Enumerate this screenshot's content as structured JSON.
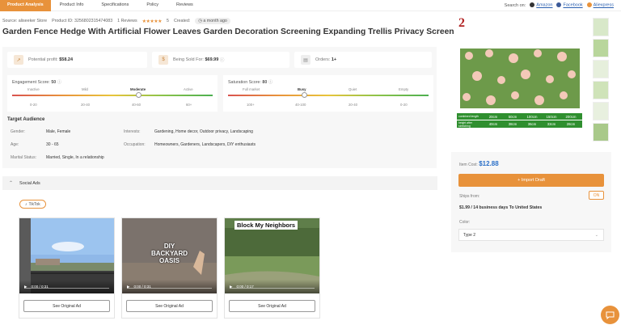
{
  "tabs": [
    "Product Analysis",
    "Product Info",
    "Specifications",
    "Policy",
    "Reviews"
  ],
  "search_on": {
    "label": "Search on:",
    "links": [
      "Amazon",
      "Facebook",
      "Aliexpress"
    ]
  },
  "meta": {
    "source": "Source: aliseeker Store",
    "product_id": "Product ID: 3256802315474083",
    "reviews": "1 Reviews",
    "stars": "★★★★★",
    "rating": "5",
    "created_label": "Created:",
    "created_value": "a month ago"
  },
  "title": "Garden Fence Hedge With Artificial Flower Leaves Garden Decoration Screening Expanding Trellis Privacy Screen",
  "stats": {
    "potential_profit_label": "Potential profit:",
    "potential_profit": "$58.24",
    "being_sold_label": "Being Sold For:",
    "being_sold": "$69.99",
    "orders_label": "Orders:",
    "orders": "1+"
  },
  "engagement": {
    "title": "Engagement Score:",
    "score": "50",
    "levels": [
      "Inactive",
      "Mild",
      "Moderate",
      "Active"
    ],
    "ranges": [
      "0-20",
      "20-40",
      "40-60",
      "60+"
    ],
    "active_level": "Moderate",
    "level_fraction": 0.63
  },
  "saturation": {
    "title": "Saturation Score:",
    "score": "80",
    "levels": [
      "Full market",
      "Busy",
      "Quiet",
      "Empty"
    ],
    "ranges": [
      "100+",
      "40-100",
      "20-40",
      "0-20"
    ],
    "active_level": "Busy",
    "level_fraction": 0.38
  },
  "audience": {
    "title": "Target Audience",
    "gender_label": "Gender:",
    "gender": "Male, Female",
    "age_label": "Age:",
    "age": "30 - 65",
    "marital_label": "Marital Status:",
    "marital": "Married, Single, In a relationship",
    "interests_label": "Interests:",
    "interests": "Gardening, Home decor, Outdoor privacy, Landscaping",
    "occupation_label": "Occupation:",
    "occupation": "Homeowners, Gardeners, Landscapers, DIY enthusiasts"
  },
  "social_ads": {
    "title": "Social Ads",
    "platform": "TikTok",
    "videos": [
      {
        "overlay": "",
        "time": "0:00 / 0:31",
        "button": "See Original Ad"
      },
      {
        "overlay": "DIY BACKYARD OASIS",
        "time": "0:00 / 0:31",
        "button": "See Original Ad"
      },
      {
        "overlay": "Block My Neighbors",
        "time": "0:00 / 0:17",
        "button": "See Original Ad"
      }
    ]
  },
  "right": {
    "image_number": "2",
    "size_table": {
      "row1_label": "combined length",
      "row2_label": "height after stretching",
      "lengths": [
        "20cm",
        "50cm",
        "100cm",
        "150cm",
        "200cm"
      ],
      "heights": [
        "40cm",
        "38cm",
        "36cm",
        "33cm",
        "28cm"
      ]
    },
    "item_cost_label": "Item Cost:",
    "item_cost": "$12.88",
    "import_button": "Import Draft",
    "ships_from_label": "Ships from:",
    "ships_value": "$1.99 / 14 business days",
    "ships_to": "To United States",
    "on_label": "ON",
    "color_label": "Color:",
    "color_value": "Type 2"
  },
  "colors": {
    "accent": "#e8923b",
    "link": "#2a6fc8",
    "number_red": "#b22222"
  }
}
